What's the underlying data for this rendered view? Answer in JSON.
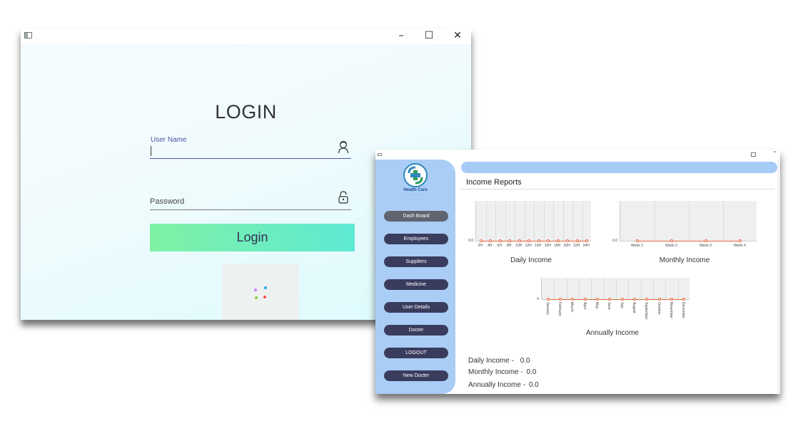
{
  "login_window": {
    "window_controls": {
      "minimize": "–",
      "maximize": "☐",
      "close": "✕"
    },
    "title": "LOGIN",
    "username": {
      "label": "User Name",
      "value": "",
      "icon": "user-icon"
    },
    "password": {
      "label": "Password",
      "value": "",
      "icon": "lock-icon"
    },
    "login_button": "Login",
    "loader_icon": "loading-spinner-icon"
  },
  "dashboard_window": {
    "brand": {
      "name": "Health Care",
      "sub": "• • • • •",
      "logo_icon": "health-care-logo-icon"
    },
    "nav": [
      {
        "label": "Dash Board",
        "active": true
      },
      {
        "label": "Employees"
      },
      {
        "label": "Suppliers"
      },
      {
        "label": "Medicine"
      },
      {
        "label": "User Details"
      },
      {
        "label": "Docter"
      },
      {
        "label": "LOGOUT"
      },
      {
        "label": "New Docter"
      }
    ],
    "section_title": "Income Reports",
    "summary": [
      {
        "label": "Daily Income -",
        "value": "0.0"
      },
      {
        "label": "Monthly Income -",
        "value": "0.0"
      },
      {
        "label": "Annually Income -",
        "value": "0.0"
      }
    ],
    "colors": {
      "sidebar": "#a9cdf5",
      "nav_button": "#3a3c5e",
      "series": "#e8663c",
      "login_button_start": "#7ff2a4",
      "login_button_end": "#5fe9d4"
    }
  },
  "chart_data": [
    {
      "type": "line",
      "title": "Daily Income",
      "categories": [
        "2H",
        "4H",
        "6H",
        "8H",
        "10H",
        "12H",
        "14H",
        "16H",
        "18H",
        "20H",
        "22H",
        "24H"
      ],
      "values": [
        0,
        0,
        0,
        0,
        0,
        0,
        0,
        0,
        0,
        0,
        0,
        0
      ],
      "ytick": "0.0"
    },
    {
      "type": "line",
      "title": "Monthly Income",
      "categories": [
        "Week 1",
        "Week 2",
        "Week 3",
        "Week 4"
      ],
      "values": [
        0,
        0,
        0,
        0
      ],
      "ytick": "0.0"
    },
    {
      "type": "line",
      "title": "Annually Income",
      "categories": [
        "January",
        "February",
        "March",
        "April",
        "May",
        "June",
        "July",
        "August",
        "September",
        "October",
        "November",
        "December"
      ],
      "values": [
        0,
        0,
        0,
        0,
        0,
        0,
        0,
        0,
        0,
        0,
        0,
        0
      ],
      "ytick": "0"
    }
  ]
}
